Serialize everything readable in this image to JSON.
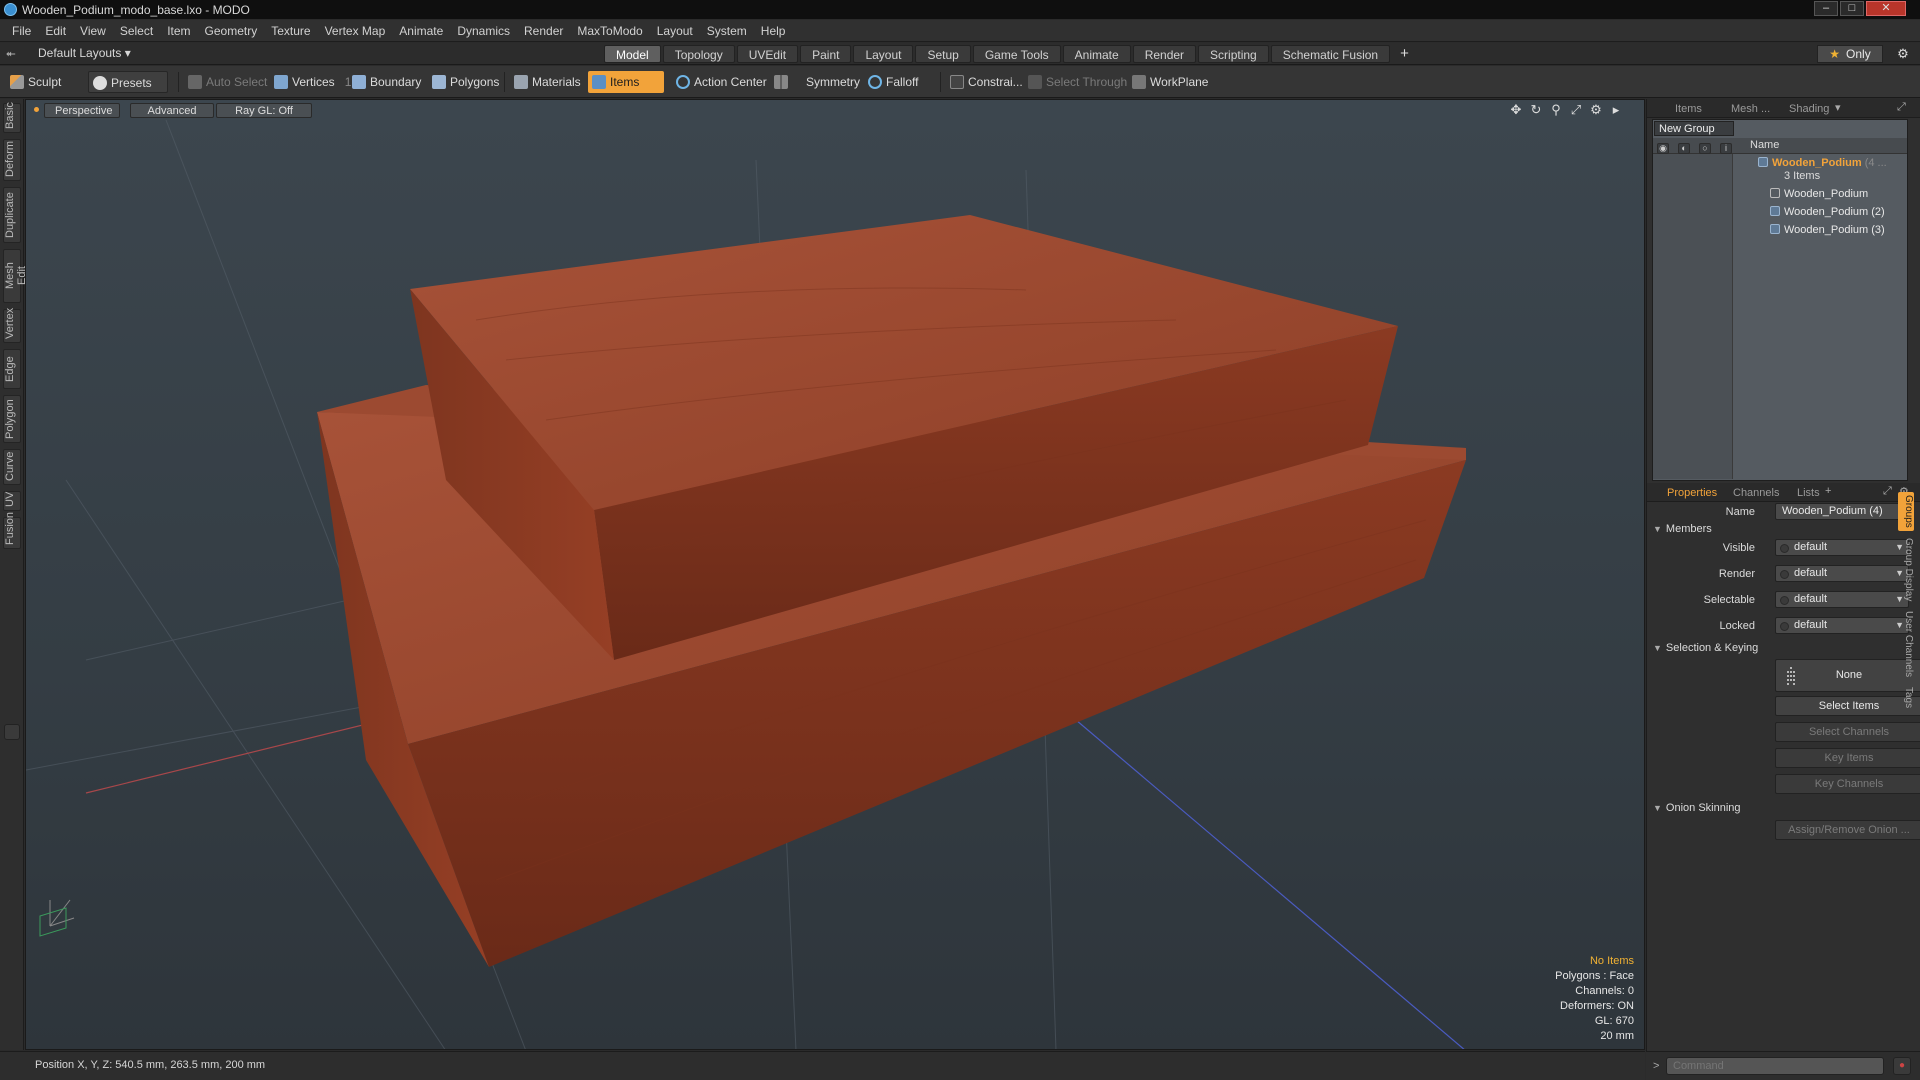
{
  "window": {
    "title": "Wooden_Podium_modo_base.lxo - MODO",
    "min": "–",
    "max": "□",
    "close": "✕"
  },
  "menu": [
    "File",
    "Edit",
    "View",
    "Select",
    "Item",
    "Geometry",
    "Texture",
    "Vertex Map",
    "Animate",
    "Dynamics",
    "Render",
    "MaxToModo",
    "Layout",
    "System",
    "Help"
  ],
  "layouts": {
    "label": "Default Layouts ▾",
    "pin": "⯬"
  },
  "tabs": [
    "Model",
    "Topology",
    "UVEdit",
    "Paint",
    "Layout",
    "Setup",
    "Game Tools",
    "Animate",
    "Render",
    "Scripting",
    "Schematic Fusion"
  ],
  "active_tab": "Model",
  "tab_add": "+",
  "only": {
    "label": "Only",
    "star": "★"
  },
  "gear": "⚙",
  "toolbar": {
    "sculpt": "Sculpt",
    "presets": "Presets",
    "auto_select": "Auto Select",
    "vertices": "Vertices",
    "vertices_count": "1",
    "boundary": "Boundary",
    "polygons": "Polygons",
    "materials": "Materials",
    "items": "Items",
    "action_center": "Action Center",
    "symmetry": "Symmetry",
    "falloff": "Falloff",
    "constraints": "Constrai...",
    "select_through": "Select Through",
    "workplane": "WorkPlane"
  },
  "left_tabs": [
    "Basic",
    "Deform",
    "Duplicate",
    "Mesh Edit",
    "Vertex",
    "Edge",
    "Polygon",
    "Curve",
    "UV",
    "Fusion"
  ],
  "viewport": {
    "perspective": "Perspective",
    "advanced": "Advanced",
    "raygl": "Ray GL: Off",
    "icons": [
      "✥",
      "↻",
      "⚲",
      "⤢",
      "⚙",
      "▸"
    ],
    "stats": {
      "no_items": "No Items",
      "polygons": "Polygons : Face",
      "channels": "Channels: 0",
      "deformers": "Deformers: ON",
      "gl": "GL: 670",
      "unit": "20 mm"
    }
  },
  "status": {
    "position": "Position X, Y, Z:   540.5 mm, 263.5 mm, 200 mm"
  },
  "items_panel": {
    "tabs": [
      "Items",
      "Mesh ...",
      "Shading"
    ],
    "new_group": "New Group",
    "col_name": "Name",
    "group_name": "Wooden_Podium",
    "group_count_suffix": "(4 ...",
    "group_items": "3 Items",
    "children": [
      "Wooden_Podium",
      "Wooden_Podium (2)",
      "Wooden_Podium (3)"
    ]
  },
  "props_panel": {
    "tabs": [
      "Properties",
      "Channels",
      "Lists"
    ],
    "add": "+",
    "name_label": "Name",
    "name_value": "Wooden_Podium (4)",
    "members": "Members",
    "visible_label": "Visible",
    "render_label": "Render",
    "selectable_label": "Selectable",
    "locked_label": "Locked",
    "default_value": "default",
    "selection_keying": "Selection & Keying",
    "none": "None",
    "select_items": "Select Items",
    "select_channels": "Select Channels",
    "key_items": "Key Items",
    "key_channels": "Key Channels",
    "onion": "Onion Skinning",
    "assign_onion": "Assign/Remove Onion ..."
  },
  "right_vtabs": [
    "Groups",
    "Group Display",
    "User Channels",
    "Tags"
  ],
  "command": {
    "placeholder": "Command"
  },
  "colors": {
    "accent": "#f2a33a",
    "wood": "#8e3e25",
    "viewport_bg": "#3a444c"
  }
}
